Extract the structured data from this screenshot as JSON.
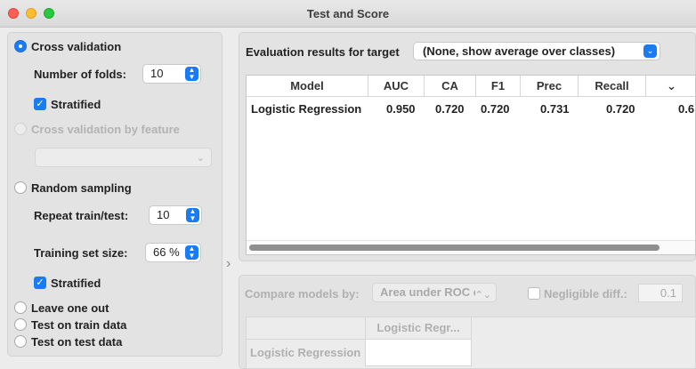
{
  "window": {
    "title": "Test and Score"
  },
  "sampling": {
    "cross_validation": {
      "label": "Cross validation",
      "selected": true
    },
    "folds": {
      "label": "Number of folds:",
      "value": "10"
    },
    "stratified_cv": {
      "label": "Stratified",
      "checked": true
    },
    "cv_by_feature": {
      "label": "Cross validation by feature",
      "enabled": false
    },
    "random_sampling": {
      "label": "Random sampling",
      "selected": false
    },
    "repeat": {
      "label": "Repeat train/test:",
      "value": "10"
    },
    "train_size": {
      "label": "Training set size:",
      "value": "66 %"
    },
    "stratified_rs": {
      "label": "Stratified",
      "checked": true
    },
    "leave_one_out": {
      "label": "Leave one out"
    },
    "test_on_train": {
      "label": "Test on train data"
    },
    "test_on_test": {
      "label": "Test on test data"
    }
  },
  "evaluation": {
    "target_label": "Evaluation results for target",
    "target_value": "(None, show average over classes)",
    "columns": [
      "Model",
      "AUC",
      "CA",
      "F1",
      "Prec",
      "Recall"
    ],
    "rows": [
      {
        "model": "Logistic Regression",
        "auc": "0.950",
        "ca": "0.720",
        "f1": "0.720",
        "prec": "0.731",
        "recall": "0.720",
        "partial": "0.6"
      }
    ]
  },
  "compare": {
    "label": "Compare models by:",
    "value": "Area under ROC c",
    "negligible_label": "Negligible diff.:",
    "negligible_value": "0.1",
    "matrix_col": "Logistic Regr...",
    "matrix_row": "Logistic Regression"
  },
  "colors": {
    "accent": "#1a7cf5"
  }
}
